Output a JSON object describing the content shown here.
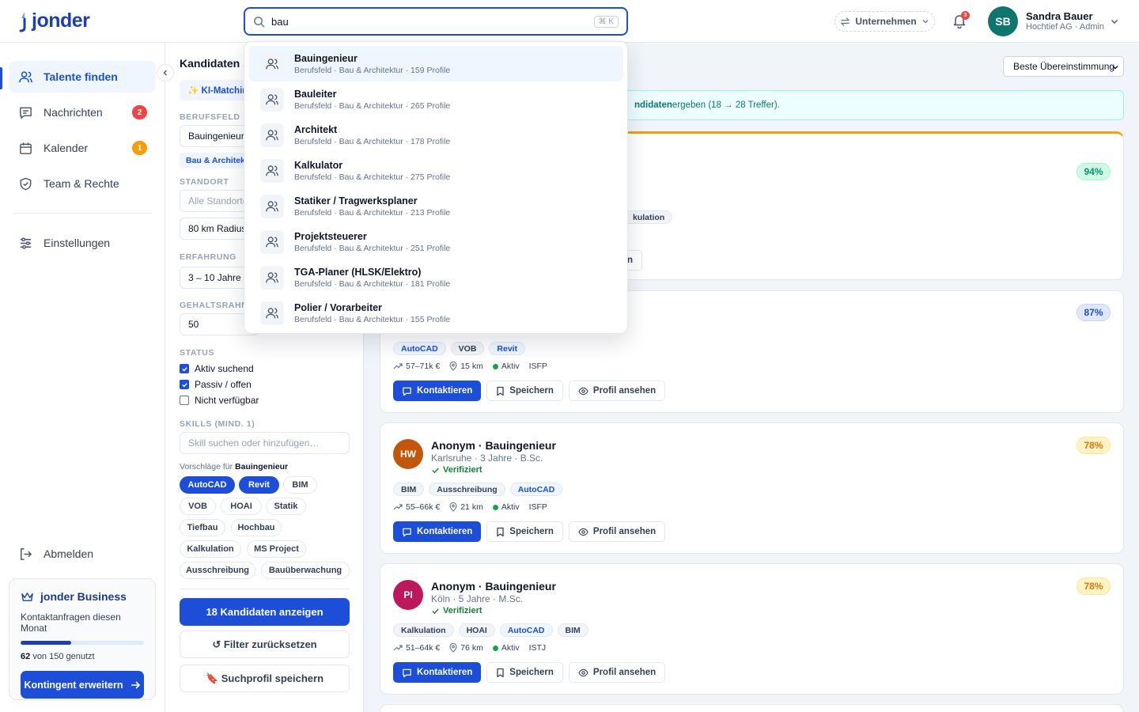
{
  "brand": {
    "name": "jonder",
    "color": "#1e40af"
  },
  "search": {
    "value": "bau",
    "placeholder": "",
    "shortcut": "⌘ K"
  },
  "topbar": {
    "company_label": "Unternehmen",
    "notif_count": "3",
    "user_initials": "SB",
    "user_name": "Sandra Bauer",
    "user_role": "Hochtief AG · Admin"
  },
  "sidebar": {
    "items": [
      {
        "label": "Talente finden",
        "icon": "users-icon",
        "active": true,
        "badge": ""
      },
      {
        "label": "Nachrichten",
        "icon": "message-icon",
        "badge": "2",
        "badge_color": "#ef4444"
      },
      {
        "label": "Kalender",
        "icon": "calendar-icon",
        "badge": "1",
        "badge_color": "#f59e0b"
      },
      {
        "label": "Team & Rechte",
        "icon": "shield-icon",
        "badge": ""
      },
      {
        "label": "Einstellungen",
        "icon": "sliders-icon",
        "badge": ""
      }
    ],
    "logout": "Abmelden",
    "business": {
      "title": "jonder Business",
      "subtitle": "Kontaktanfragen diesen Monat",
      "used": "62",
      "used_suffix": "von 150 genutzt",
      "progress": 0.413,
      "cta": "Kontingent erweitern"
    }
  },
  "filter": {
    "title": "Kandidaten su",
    "ai_label": "✨ KI-Matchin",
    "berufsfeld_label": "BERUFSFELD",
    "berufsfeld_value": "Bauingenieur",
    "berufsfeld_chip": "Bau & Architekt",
    "standort_label": "STANDORT",
    "standort_placeholder": "Alle Standorte",
    "radius_value": "80 km Radius",
    "erfahrung_label": "ERFAHRUNG",
    "erfahrung_value": "3 – 10 Jahre",
    "gehalt_label": "GEHALTSRAHM",
    "gehalt_value": "50",
    "status_label": "STATUS",
    "status_options": [
      {
        "label": "Aktiv suchend",
        "checked": true
      },
      {
        "label": "Passiv / offen",
        "checked": true
      },
      {
        "label": "Nicht verfügbar",
        "checked": false
      }
    ],
    "skills_label": "SKILLS (MIND. 1)",
    "skills_placeholder": "Skill suchen oder hinzufügen…",
    "suggestions_prefix": "Vorschläge für",
    "suggestions_for": "Bauingenieur",
    "skills": [
      {
        "label": "AutoCAD",
        "selected": true
      },
      {
        "label": "Revit",
        "selected": true
      },
      {
        "label": "BIM",
        "selected": false
      },
      {
        "label": "VOB",
        "selected": false
      },
      {
        "label": "HOAI",
        "selected": false
      },
      {
        "label": "Statik",
        "selected": false
      },
      {
        "label": "Tiefbau",
        "selected": false
      },
      {
        "label": "Hochbau",
        "selected": false
      },
      {
        "label": "Kalkulation",
        "selected": false
      },
      {
        "label": "MS Project",
        "selected": false
      },
      {
        "label": "Ausschreibung",
        "selected": false
      },
      {
        "label": "Bauüberwachung",
        "selected": false
      }
    ],
    "show_button": "18 Kandidaten anzeigen",
    "reset_button": "↺ Filter zurücksetzen",
    "save_button": "🔖 Suchprofil speichern"
  },
  "main": {
    "sort_value": "Beste Übereinstimmung",
    "banner_bold": "ndidaten",
    "banner_rest": " ergeben (18 → 28 Treffer).",
    "card1": {
      "match": "94%",
      "tag_partial": "kulation",
      "action_partial": "n"
    },
    "card2": {
      "match": "87%",
      "tags": [
        "AutoCAD",
        "VOB",
        "Revit"
      ],
      "salary": "57–71k €",
      "distance": "15 km",
      "status": "Aktiv",
      "personality": "ISFP"
    },
    "cards": [
      {
        "initials": "HW",
        "avatar_color": "#c2570c",
        "name": "Anonym · Bauingenieur",
        "meta": "Karlsruhe · 3 Jahre · B.Sc.",
        "verified": "Verifiziert",
        "match": "78%",
        "tags": [
          "BIM",
          "Ausschreibung",
          "AutoCAD"
        ],
        "salary": "55–66k €",
        "distance": "21 km",
        "status": "Aktiv",
        "personality": "ISFP"
      },
      {
        "initials": "PI",
        "avatar_color": "#be185d",
        "name": "Anonym · Bauingenieur",
        "meta": "Köln · 5 Jahre · M.Sc.",
        "verified": "Verifiziert",
        "match": "78%",
        "tags": [
          "Kalkulation",
          "HOAI",
          "AutoCAD",
          "BIM"
        ],
        "salary": "51–64k €",
        "distance": "76 km",
        "status": "Aktiv",
        "personality": "ISTJ"
      }
    ],
    "actions": {
      "contact": "Kontaktieren",
      "save": "Speichern",
      "profile": "Profil ansehen"
    }
  },
  "dropdown": {
    "items": [
      {
        "title": "Bauingenieur",
        "sub": "Berufsfeld · Bau & Architektur · 159 Profile"
      },
      {
        "title": "Bauleiter",
        "sub": "Berufsfeld · Bau & Architektur · 265 Profile"
      },
      {
        "title": "Architekt",
        "sub": "Berufsfeld · Bau & Architektur · 178 Profile"
      },
      {
        "title": "Kalkulator",
        "sub": "Berufsfeld · Bau & Architektur · 275 Profile"
      },
      {
        "title": "Statiker / Tragwerksplaner",
        "sub": "Berufsfeld · Bau & Architektur · 213 Profile"
      },
      {
        "title": "Projektsteuerer",
        "sub": "Berufsfeld · Bau & Architektur · 251 Profile"
      },
      {
        "title": "TGA-Planer (HLSK/Elektro)",
        "sub": "Berufsfeld · Bau & Architektur · 181 Profile"
      },
      {
        "title": "Polier / Vorarbeiter",
        "sub": "Berufsfeld · Bau & Architektur · 155 Profile"
      }
    ]
  }
}
